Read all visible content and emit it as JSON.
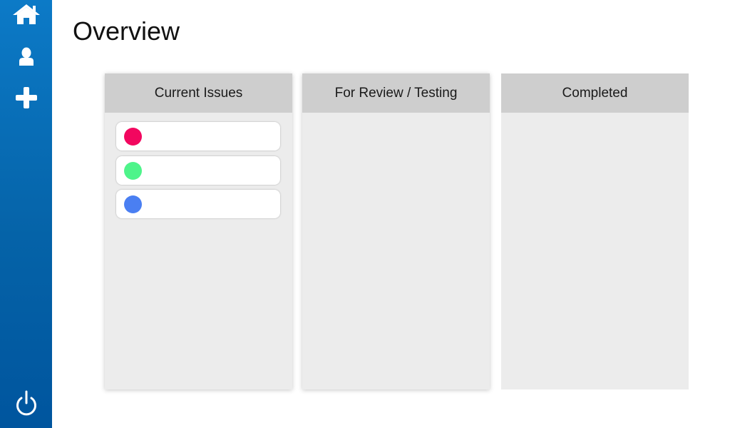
{
  "page": {
    "title": "Overview"
  },
  "sidebar": {
    "background": "#0563a8",
    "icon_color": "#ffffff",
    "items": [
      {
        "icon": "home-icon"
      },
      {
        "icon": "user-icon"
      },
      {
        "icon": "plus-icon"
      },
      {
        "icon": "power-icon"
      }
    ]
  },
  "board": {
    "columns": [
      {
        "title": "Current Issues",
        "cards": [
          {
            "color": "#f2075f"
          },
          {
            "color": "#4ef48a"
          },
          {
            "color": "#4a7ff2"
          }
        ]
      },
      {
        "title": "For Review / Testing",
        "cards": []
      },
      {
        "title": "Completed",
        "cards": []
      }
    ]
  }
}
